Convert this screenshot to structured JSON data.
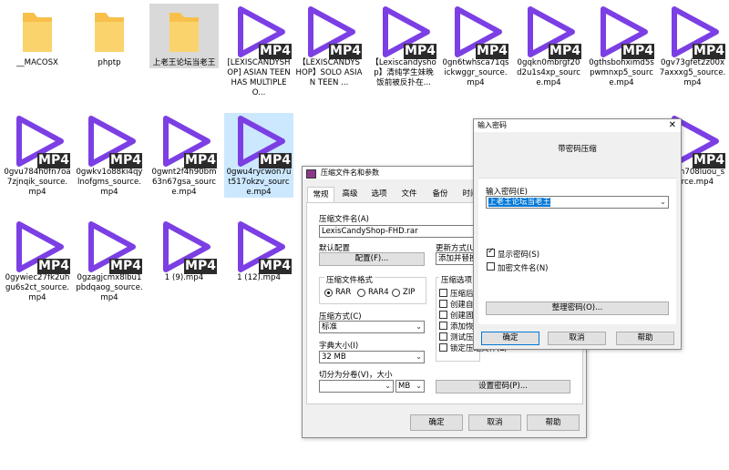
{
  "files": [
    {
      "label": "__MACOSX",
      "type": "folder"
    },
    {
      "label": "phptp",
      "type": "folder"
    },
    {
      "label": "上老王论坛当老王",
      "type": "folder"
    },
    {
      "label": "[LEXISCANDYSHOP] ASIAN TEEN HAS MULTIPLE O...",
      "type": "mp4"
    },
    {
      "label": "【LEXISCANDYSHOP】SOLO ASIAN TEEN ...",
      "type": "mp4"
    },
    {
      "label": "【Lexiscandyshop】清纯学生妹晚饭前被反扑在...",
      "type": "mp4"
    },
    {
      "label": "0gn6twhsca71qsickwggr_source.mp4",
      "type": "mp4"
    },
    {
      "label": "0gqkn0mbrgf20d2u1s4xp_source.mp4",
      "type": "mp4"
    },
    {
      "label": "0gthsbohximd5spwmnxp5_source.mp4",
      "type": "mp4"
    },
    {
      "label": "0gv73gfet2z00x7axxxg5_source.mp4",
      "type": "mp4"
    },
    {
      "label": "0gvu784h0fn7oa7zjnqik_source.mp4",
      "type": "mp4"
    },
    {
      "label": "0gwkv1o88ki4qylnofgms_source.mp4",
      "type": "mp4"
    },
    {
      "label": "0gwnt2f4h90bm63n67gsa_source.mp4",
      "type": "mp4"
    },
    {
      "label": "0gwu4rycwon7ut517okzv_source.mp4",
      "type": "mp4"
    },
    {
      "label": "0gywiec27fk2uhgu6s2ct_source.mp4",
      "type": "mp4"
    },
    {
      "label": "0gzagjcmx8lbu1pbdqaog_source.mp4",
      "type": "mp4"
    },
    {
      "label": "1 (9).mp4",
      "type": "mp4"
    },
    {
      "label": "1 (12).mp4",
      "type": "mp4"
    },
    {
      "label": "y1nkn708luou_source.mp4",
      "type": "mp4"
    }
  ],
  "mp4_badge": "MP4",
  "colors": {
    "play_icon": "#7b3fe4",
    "folder": "#f8c04a",
    "selection": "#cce8ff"
  },
  "archive_dialog": {
    "title": "压缩文件名和参数",
    "tabs": [
      "常规",
      "高级",
      "选项",
      "文件",
      "备份",
      "时间"
    ],
    "archive_name_label": "压缩文件名(A)",
    "archive_name_value": "LexisCandyShop-FHD.rar",
    "default_profile_label": "默认配置",
    "profile_button": "配置(F)...",
    "update_mode_label": "更新方式(U)",
    "update_mode_value": "添加并替换",
    "format_label": "压缩文件格式",
    "format_rar": "RAR",
    "format_rar4": "RAR4",
    "format_zip": "ZIP",
    "method_label": "压缩方式(C)",
    "method_value": "标准",
    "dict_label": "字典大小(I)",
    "dict_value": "32 MB",
    "split_label": "切分为分卷(V)，大小",
    "split_unit": "MB",
    "options_label": "压缩选项",
    "options": [
      "压缩后",
      "创建自",
      "创建固",
      "添加恢",
      "测试压",
      "锁定压缩文件(L)"
    ],
    "set_password_button": "设置密码(P)...",
    "ok": "确定",
    "cancel": "取消",
    "help": "帮助"
  },
  "password_dialog": {
    "title": "输入密码",
    "heading": "带密码压缩",
    "input_label": "输入密码(E)",
    "input_value": "上老王论坛当老王",
    "show_password": "显示密码(S)",
    "encrypt_names": "加密文件名(N)",
    "organize_button": "整理密码(O)...",
    "ok": "确定",
    "cancel": "取消",
    "help": "帮助"
  }
}
